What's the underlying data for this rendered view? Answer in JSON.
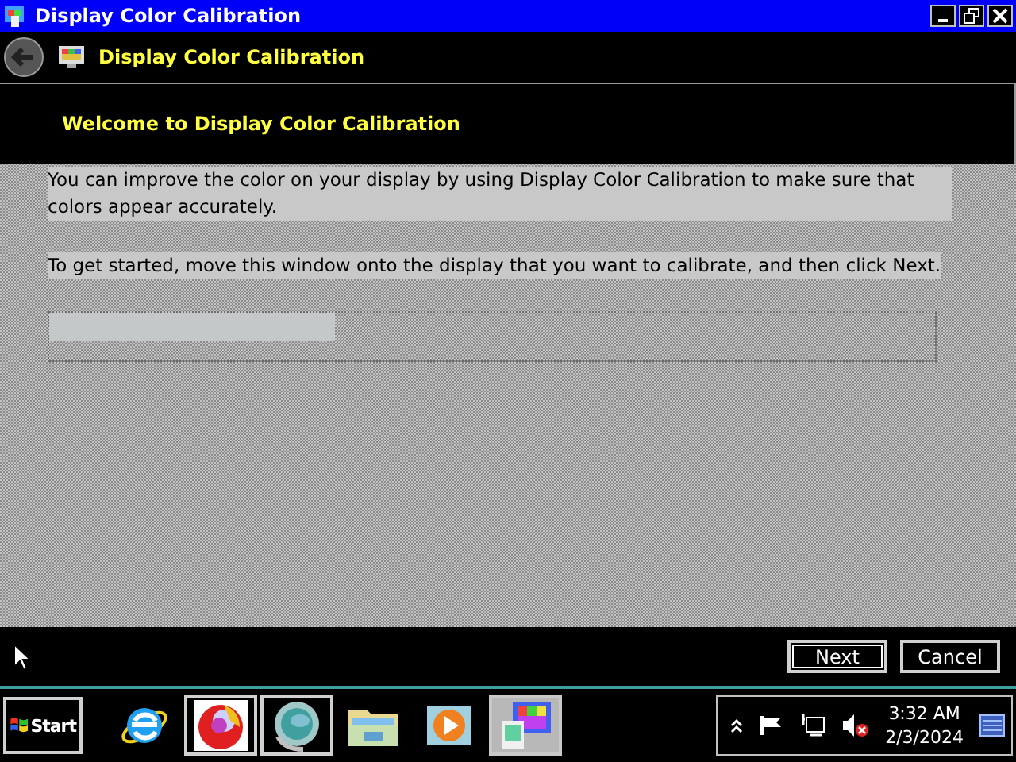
{
  "window": {
    "title": "Display Color Calibration"
  },
  "header": {
    "title": "Display Color Calibration"
  },
  "page": {
    "heading": "Welcome to Display Color Calibration",
    "paragraphs": [
      "You can improve the color on your display by using Display Color Calibration to make sure that colors appear accurately.",
      "To get started, move this window onto the display that you want to calibrate, and then click Next."
    ]
  },
  "buttons": [
    {
      "label": "Next",
      "default": true
    },
    {
      "label": "Cancel",
      "default": false
    }
  ],
  "taskbar": {
    "start": "Start",
    "apps": [
      {
        "kind": "browser",
        "running": false,
        "selected": false
      },
      {
        "kind": "fox",
        "running": true,
        "selected": false
      },
      {
        "kind": "orb",
        "running": true,
        "selected": false
      },
      {
        "kind": "folder",
        "running": false,
        "selected": false
      },
      {
        "kind": "media",
        "running": false,
        "selected": false
      },
      {
        "kind": "calibration",
        "running": true,
        "selected": true
      }
    ],
    "clock": {
      "time": "3:32 AM",
      "date": "2/3/2024"
    }
  }
}
